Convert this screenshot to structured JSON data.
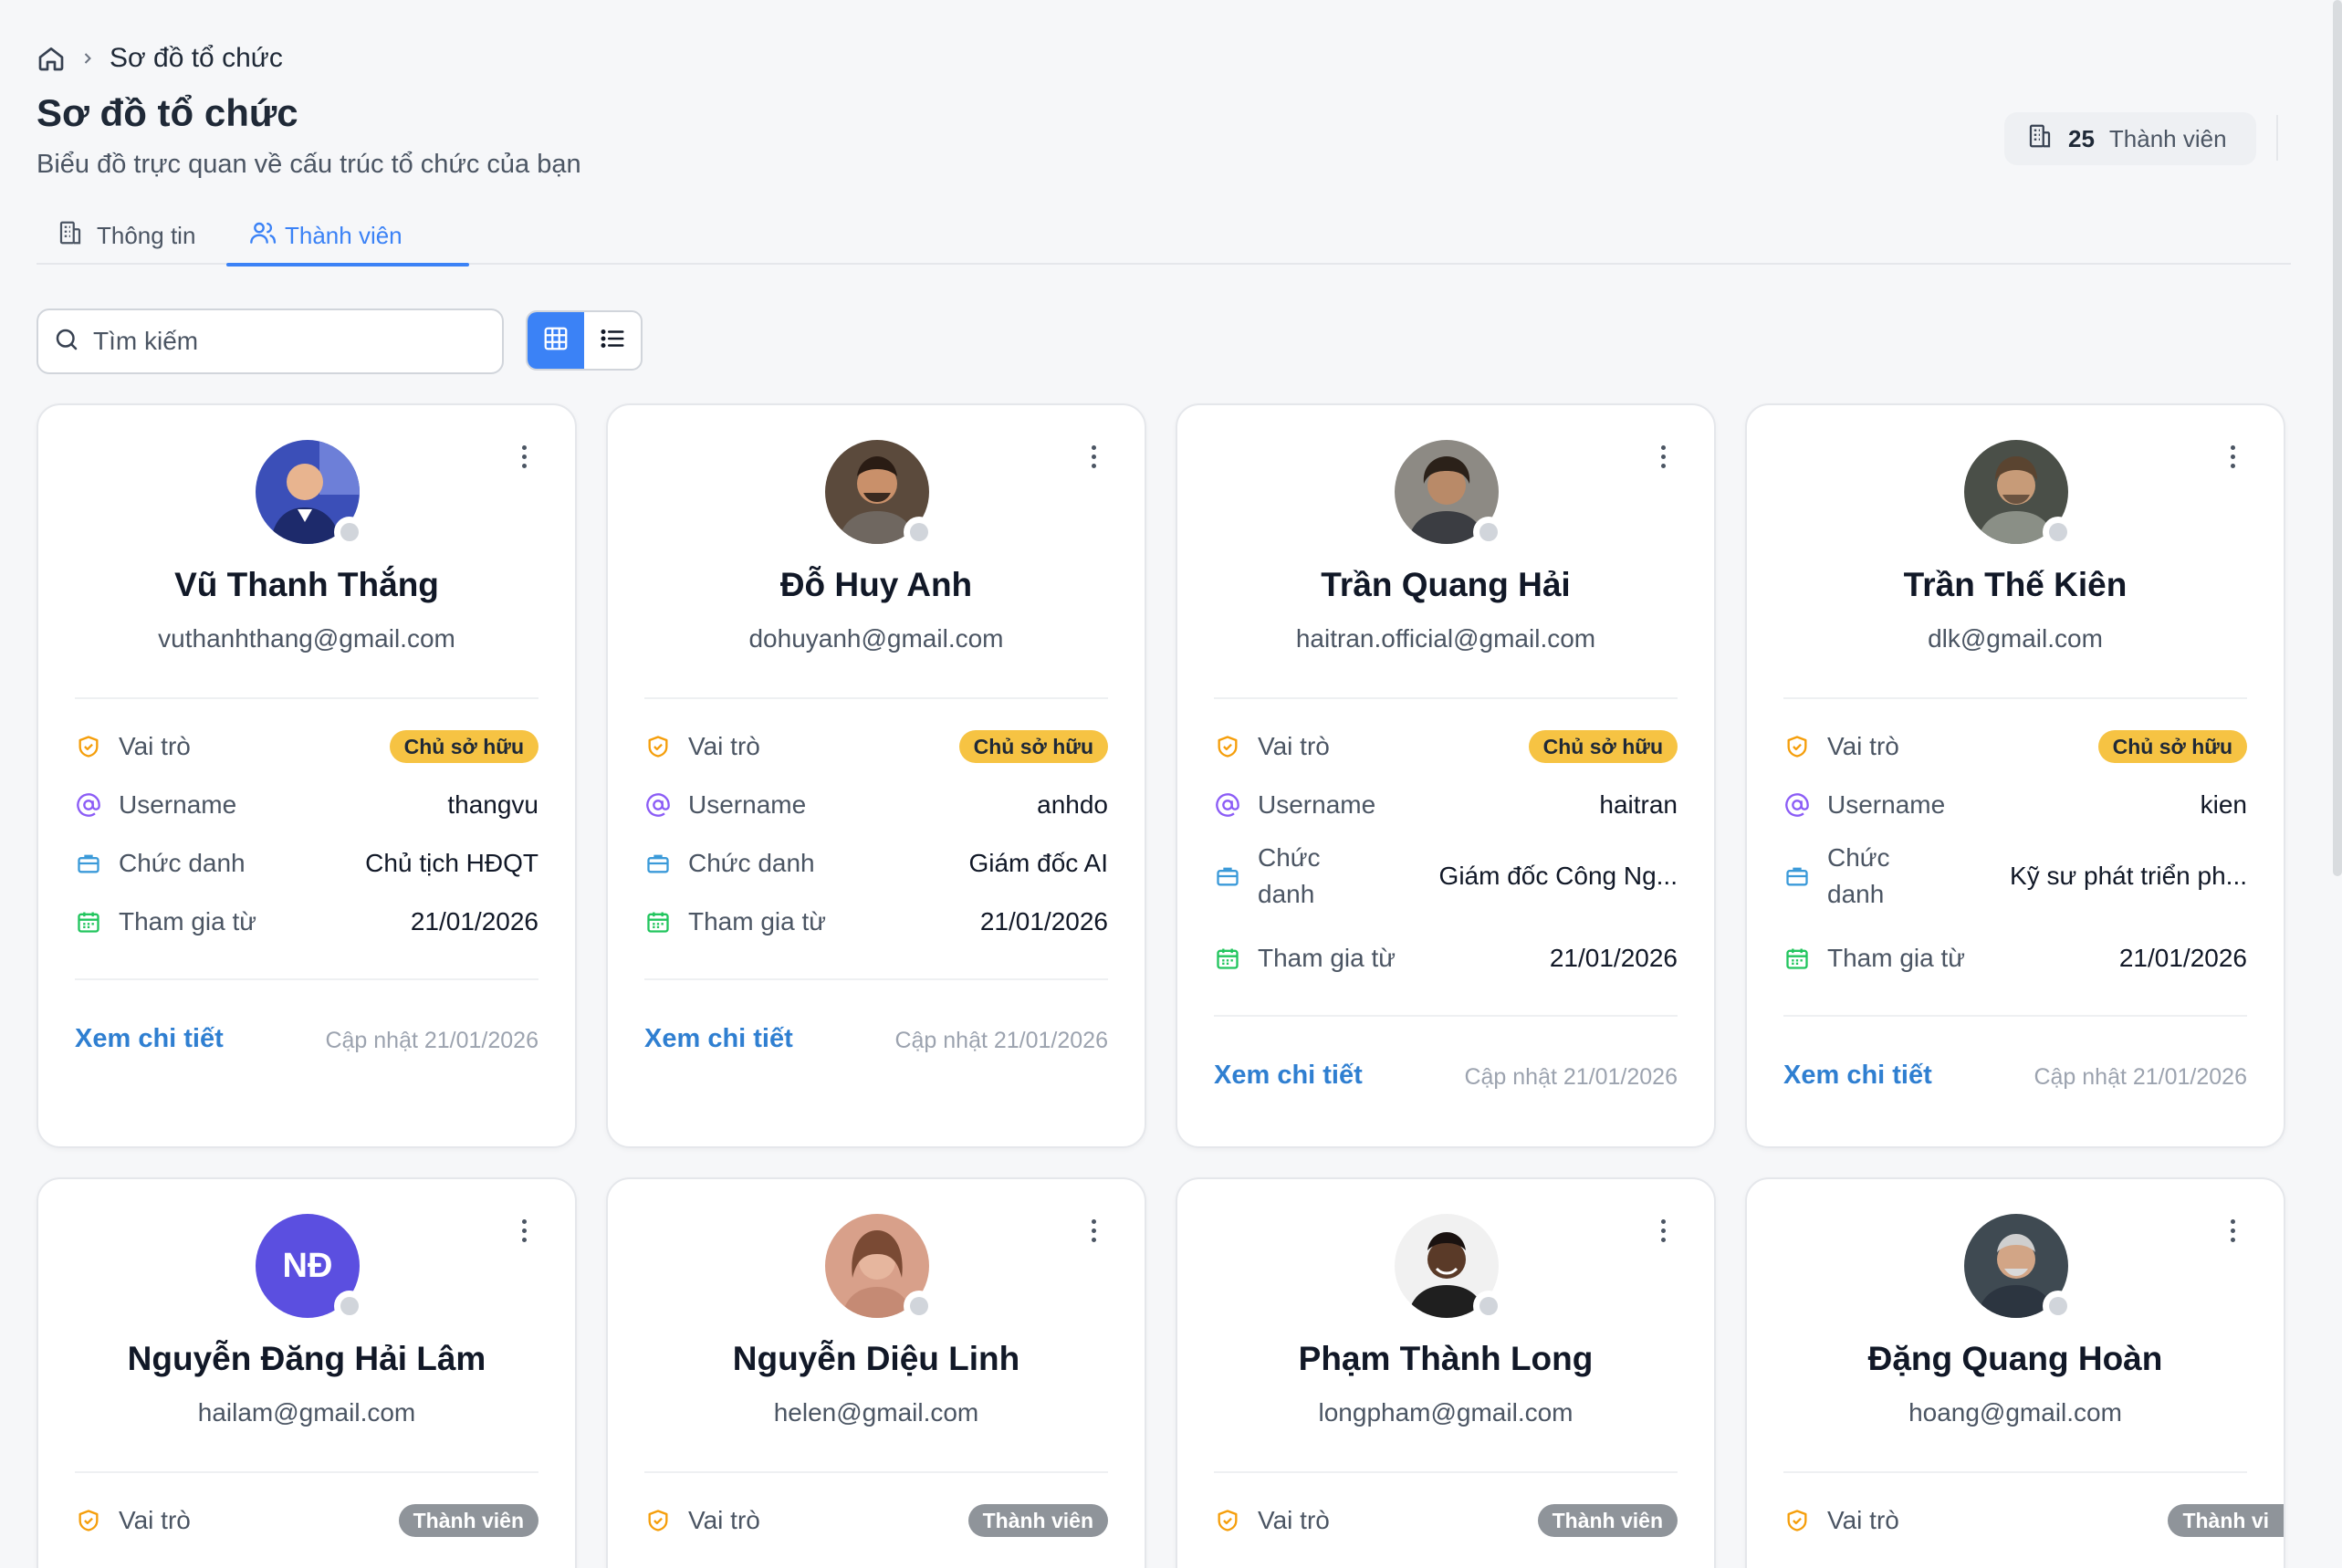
{
  "breadcrumb": {
    "current": "Sơ đồ tổ chức"
  },
  "header": {
    "title": "Sơ đồ tổ chức",
    "subtitle": "Biểu đồ trực quan về cấu trúc tổ chức của bạn",
    "member_count": "25",
    "member_count_label": "Thành viên"
  },
  "tabs": [
    {
      "label": "Thông tin",
      "active": false
    },
    {
      "label": "Thành viên",
      "active": true
    }
  ],
  "search": {
    "placeholder": "Tìm kiếm",
    "value": ""
  },
  "labels": {
    "role": "Vai trò",
    "username": "Username",
    "title": "Chức danh",
    "title_wrapped_1": "Chức",
    "title_wrapped_2": "danh",
    "joined": "Tham gia từ",
    "detail": "Xem chi tiết"
  },
  "members": [
    {
      "name": "Vũ Thanh Thắng",
      "email": "vuthanhthang@gmail.com",
      "role": "Chủ sở hữu",
      "username": "thangvu",
      "title": "Chủ tịch HĐQT",
      "joined": "21/01/2026",
      "updated": "Cập nhật 21/01/2026"
    },
    {
      "name": "Đỗ Huy Anh",
      "email": "dohuyanh@gmail.com",
      "role": "Chủ sở hữu",
      "username": "anhdo",
      "title": "Giám đốc AI",
      "joined": "21/01/2026",
      "updated": "Cập nhật 21/01/2026"
    },
    {
      "name": "Trần Quang Hải",
      "email": "haitran.official@gmail.com",
      "role": "Chủ sở hữu",
      "username": "haitran",
      "title": "Giám đốc Công Ng...",
      "joined": "21/01/2026",
      "updated": "Cập nhật 21/01/2026"
    },
    {
      "name": "Trần Thế Kiên",
      "email": "dlk@gmail.com",
      "role": "Chủ sở hữu",
      "username": "kien",
      "title": "Kỹ sư phát triển ph...",
      "joined": "21/01/2026",
      "updated": "Cập nhật 21/01/2026"
    },
    {
      "name": "Nguyễn Đăng Hải Lâm",
      "email": "hailam@gmail.com",
      "role": "Thành viên",
      "initials": "NĐ"
    },
    {
      "name": "Nguyễn Diệu Linh",
      "email": "helen@gmail.com",
      "role": "Thành viên"
    },
    {
      "name": "Phạm Thành Long",
      "email": "longpham@gmail.com",
      "role": "Thành viên"
    },
    {
      "name": "Đặng Quang Hoàn",
      "email": "hoang@gmail.com",
      "role": "Thành vi"
    }
  ],
  "colors": {
    "accent": "#3b82f6",
    "owner_badge": "#f6c343",
    "member_badge": "#8f949a",
    "link": "#2f7fd1"
  }
}
